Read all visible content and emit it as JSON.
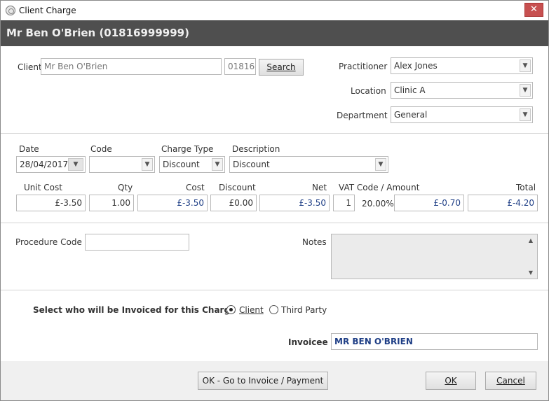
{
  "window": {
    "title": "Client Charge",
    "close_label": "✕",
    "banner": "Mr Ben O'Brien (01816999999)"
  },
  "client": {
    "label": "Client",
    "name_value": "Mr Ben O'Brien",
    "code_value": "01816",
    "search_label": "Search"
  },
  "practitioner": {
    "label": "Practitioner",
    "value": "Alex Jones"
  },
  "location": {
    "label": "Location",
    "value": "Clinic A"
  },
  "department": {
    "label": "Department",
    "value": "General"
  },
  "charge": {
    "date_label": "Date",
    "date_value": "28/04/2017",
    "code_label": "Code",
    "code_value": "",
    "charge_type_label": "Charge Type",
    "charge_type_value": "Discount",
    "description_label": "Description",
    "description_value": "Discount",
    "unit_cost_label": "Unit Cost",
    "unit_cost_value": "£-3.50",
    "qty_label": "Qty",
    "qty_value": "1.00",
    "cost_label": "Cost",
    "cost_value": "£-3.50",
    "discount_label": "Discount",
    "discount_value": "£0.00",
    "net_label": "Net",
    "net_value": "£-3.50",
    "vat_label": "VAT Code / Amount",
    "vat_code_value": "1",
    "vat_rate": "20.00%",
    "vat_amount_value": "£-0.70",
    "total_label": "Total",
    "total_value": "£-4.20"
  },
  "procedure": {
    "label": "Procedure Code",
    "value": ""
  },
  "notes": {
    "label": "Notes"
  },
  "invoice": {
    "question": "Select who will be Invoiced for this Charge",
    "option_client": "Client",
    "option_third_party": "Third Party",
    "selected": "Client",
    "invoicee_label": "Invoicee",
    "invoicee_value": "MR BEN O'BRIEN"
  },
  "footer": {
    "go_invoice_label": "OK - Go to Invoice / Payment",
    "ok_label": "OK",
    "cancel_label": "Cancel"
  },
  "colors": {
    "banner_bg": "#4f4f4f",
    "value_blue": "#1f3f86",
    "close_red": "#c75050"
  }
}
